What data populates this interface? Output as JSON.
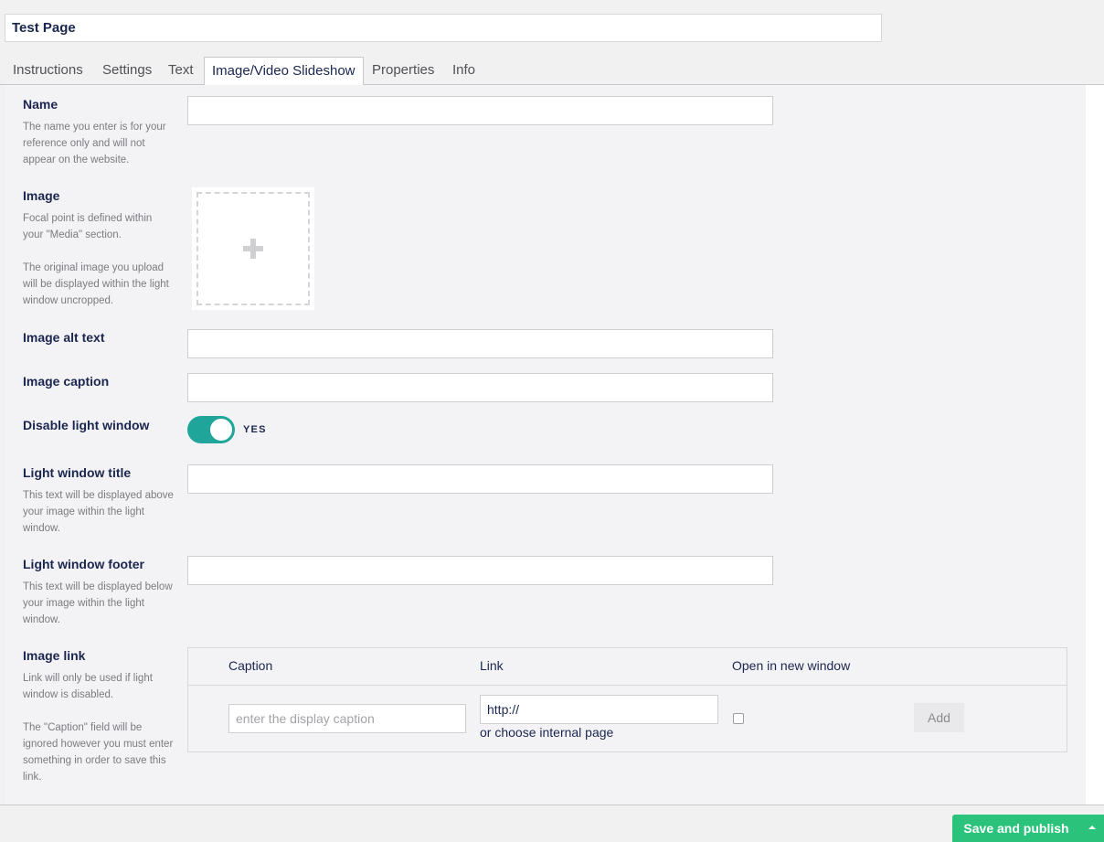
{
  "page": {
    "name_value": "Test Page"
  },
  "tabs": [
    {
      "label": "Instructions"
    },
    {
      "label": "Settings"
    },
    {
      "label": "Text"
    },
    {
      "label": "Image/Video Slideshow",
      "active": true
    },
    {
      "label": "Properties"
    },
    {
      "label": "Info"
    }
  ],
  "fields": {
    "name": {
      "label": "Name",
      "desc": "The name you enter is for your reference only and will not appear on the website."
    },
    "image": {
      "label": "Image",
      "desc1": "Focal point is defined within your \"Media\" section.",
      "desc2": "The original image you upload will be displayed within the light window uncropped."
    },
    "alt_text": {
      "label": "Image alt text"
    },
    "caption": {
      "label": "Image caption"
    },
    "disable_light_window": {
      "label": "Disable light window",
      "toggle_on": true,
      "toggle_text": "YES"
    },
    "light_window_title": {
      "label": "Light window title",
      "desc": "This text will be displayed above your image within the light window."
    },
    "light_window_footer": {
      "label": "Light window footer",
      "desc": "This text will be displayed below your image within the light window."
    },
    "image_link": {
      "label": "Image link",
      "desc1": "Link will only be used if light window is disabled.",
      "desc2": "The \"Caption\" field will be ignored however you must enter something in order to save this link."
    }
  },
  "link_table": {
    "headers": {
      "caption": "Caption",
      "link": "Link",
      "new_window": "Open in new window"
    },
    "caption_placeholder": "enter the display caption",
    "link_value": "http://",
    "choose_internal": "or choose internal page",
    "new_window_checked": false,
    "add_label": "Add"
  },
  "footer": {
    "publish_label": "Save and publish"
  },
  "colors": {
    "accent_green": "#2bc37c",
    "toggle_teal": "#1fa59a",
    "text_dark": "#1b264f"
  }
}
